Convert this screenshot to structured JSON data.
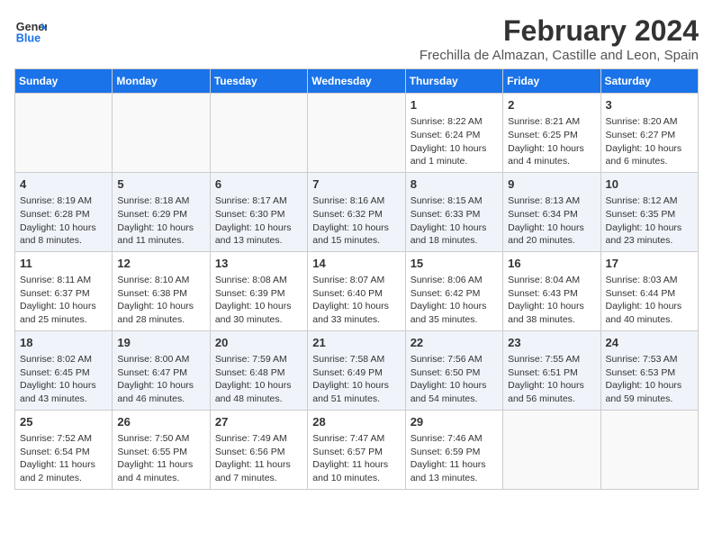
{
  "header": {
    "logo_line1": "General",
    "logo_line2": "Blue",
    "title": "February 2024",
    "subtitle": "Frechilla de Almazan, Castille and Leon, Spain"
  },
  "columns": [
    "Sunday",
    "Monday",
    "Tuesday",
    "Wednesday",
    "Thursday",
    "Friday",
    "Saturday"
  ],
  "weeks": [
    [
      {
        "day": "",
        "info": ""
      },
      {
        "day": "",
        "info": ""
      },
      {
        "day": "",
        "info": ""
      },
      {
        "day": "",
        "info": ""
      },
      {
        "day": "1",
        "info": "Sunrise: 8:22 AM\nSunset: 6:24 PM\nDaylight: 10 hours and 1 minute."
      },
      {
        "day": "2",
        "info": "Sunrise: 8:21 AM\nSunset: 6:25 PM\nDaylight: 10 hours and 4 minutes."
      },
      {
        "day": "3",
        "info": "Sunrise: 8:20 AM\nSunset: 6:27 PM\nDaylight: 10 hours and 6 minutes."
      }
    ],
    [
      {
        "day": "4",
        "info": "Sunrise: 8:19 AM\nSunset: 6:28 PM\nDaylight: 10 hours and 8 minutes."
      },
      {
        "day": "5",
        "info": "Sunrise: 8:18 AM\nSunset: 6:29 PM\nDaylight: 10 hours and 11 minutes."
      },
      {
        "day": "6",
        "info": "Sunrise: 8:17 AM\nSunset: 6:30 PM\nDaylight: 10 hours and 13 minutes."
      },
      {
        "day": "7",
        "info": "Sunrise: 8:16 AM\nSunset: 6:32 PM\nDaylight: 10 hours and 15 minutes."
      },
      {
        "day": "8",
        "info": "Sunrise: 8:15 AM\nSunset: 6:33 PM\nDaylight: 10 hours and 18 minutes."
      },
      {
        "day": "9",
        "info": "Sunrise: 8:13 AM\nSunset: 6:34 PM\nDaylight: 10 hours and 20 minutes."
      },
      {
        "day": "10",
        "info": "Sunrise: 8:12 AM\nSunset: 6:35 PM\nDaylight: 10 hours and 23 minutes."
      }
    ],
    [
      {
        "day": "11",
        "info": "Sunrise: 8:11 AM\nSunset: 6:37 PM\nDaylight: 10 hours and 25 minutes."
      },
      {
        "day": "12",
        "info": "Sunrise: 8:10 AM\nSunset: 6:38 PM\nDaylight: 10 hours and 28 minutes."
      },
      {
        "day": "13",
        "info": "Sunrise: 8:08 AM\nSunset: 6:39 PM\nDaylight: 10 hours and 30 minutes."
      },
      {
        "day": "14",
        "info": "Sunrise: 8:07 AM\nSunset: 6:40 PM\nDaylight: 10 hours and 33 minutes."
      },
      {
        "day": "15",
        "info": "Sunrise: 8:06 AM\nSunset: 6:42 PM\nDaylight: 10 hours and 35 minutes."
      },
      {
        "day": "16",
        "info": "Sunrise: 8:04 AM\nSunset: 6:43 PM\nDaylight: 10 hours and 38 minutes."
      },
      {
        "day": "17",
        "info": "Sunrise: 8:03 AM\nSunset: 6:44 PM\nDaylight: 10 hours and 40 minutes."
      }
    ],
    [
      {
        "day": "18",
        "info": "Sunrise: 8:02 AM\nSunset: 6:45 PM\nDaylight: 10 hours and 43 minutes."
      },
      {
        "day": "19",
        "info": "Sunrise: 8:00 AM\nSunset: 6:47 PM\nDaylight: 10 hours and 46 minutes."
      },
      {
        "day": "20",
        "info": "Sunrise: 7:59 AM\nSunset: 6:48 PM\nDaylight: 10 hours and 48 minutes."
      },
      {
        "day": "21",
        "info": "Sunrise: 7:58 AM\nSunset: 6:49 PM\nDaylight: 10 hours and 51 minutes."
      },
      {
        "day": "22",
        "info": "Sunrise: 7:56 AM\nSunset: 6:50 PM\nDaylight: 10 hours and 54 minutes."
      },
      {
        "day": "23",
        "info": "Sunrise: 7:55 AM\nSunset: 6:51 PM\nDaylight: 10 hours and 56 minutes."
      },
      {
        "day": "24",
        "info": "Sunrise: 7:53 AM\nSunset: 6:53 PM\nDaylight: 10 hours and 59 minutes."
      }
    ],
    [
      {
        "day": "25",
        "info": "Sunrise: 7:52 AM\nSunset: 6:54 PM\nDaylight: 11 hours and 2 minutes."
      },
      {
        "day": "26",
        "info": "Sunrise: 7:50 AM\nSunset: 6:55 PM\nDaylight: 11 hours and 4 minutes."
      },
      {
        "day": "27",
        "info": "Sunrise: 7:49 AM\nSunset: 6:56 PM\nDaylight: 11 hours and 7 minutes."
      },
      {
        "day": "28",
        "info": "Sunrise: 7:47 AM\nSunset: 6:57 PM\nDaylight: 11 hours and 10 minutes."
      },
      {
        "day": "29",
        "info": "Sunrise: 7:46 AM\nSunset: 6:59 PM\nDaylight: 11 hours and 13 minutes."
      },
      {
        "day": "",
        "info": ""
      },
      {
        "day": "",
        "info": ""
      }
    ]
  ]
}
